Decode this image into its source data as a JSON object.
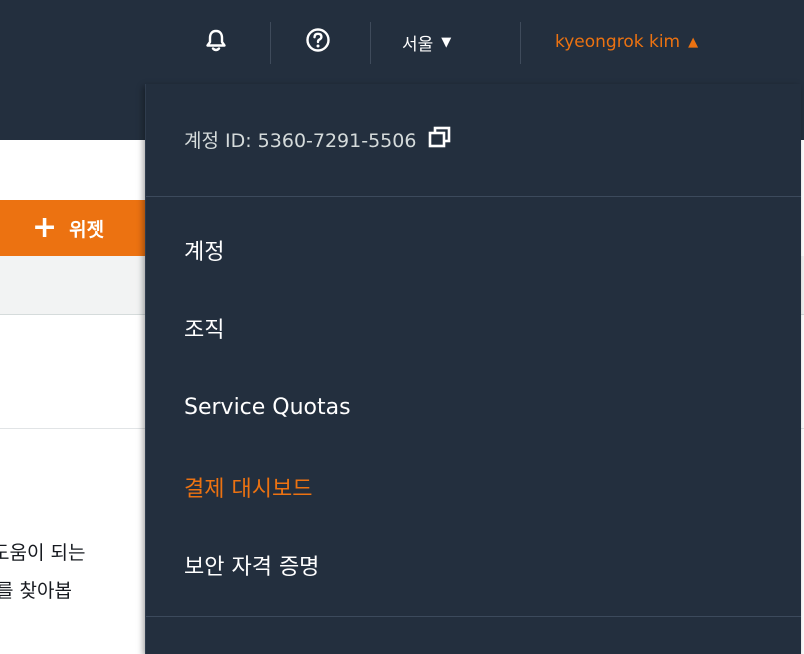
{
  "topnav": {
    "bell_icon": "bell-icon",
    "help_icon": "help-circle-icon",
    "region_label": "서울",
    "region_caret": "▼",
    "user_label": "kyeongrok kim",
    "user_caret": "▲"
  },
  "background": {
    "widget_button_plus": "+",
    "widget_button_label": "위젯",
    "text_line_1": "도움이 되는",
    "text_line_2": "를 찾아봅"
  },
  "dropdown": {
    "account_id": "계정 ID: 5360-7291-5506",
    "copy_icon": "copy-icon",
    "items": [
      {
        "label": "계정"
      },
      {
        "label": "조직"
      },
      {
        "label": "Service Quotas"
      },
      {
        "label": "결제 대시보드"
      },
      {
        "label": "보안 자격 증명"
      }
    ]
  },
  "colors": {
    "nav_bg": "#232f3e",
    "accent": "#ec7211",
    "text": "#ffffff"
  }
}
